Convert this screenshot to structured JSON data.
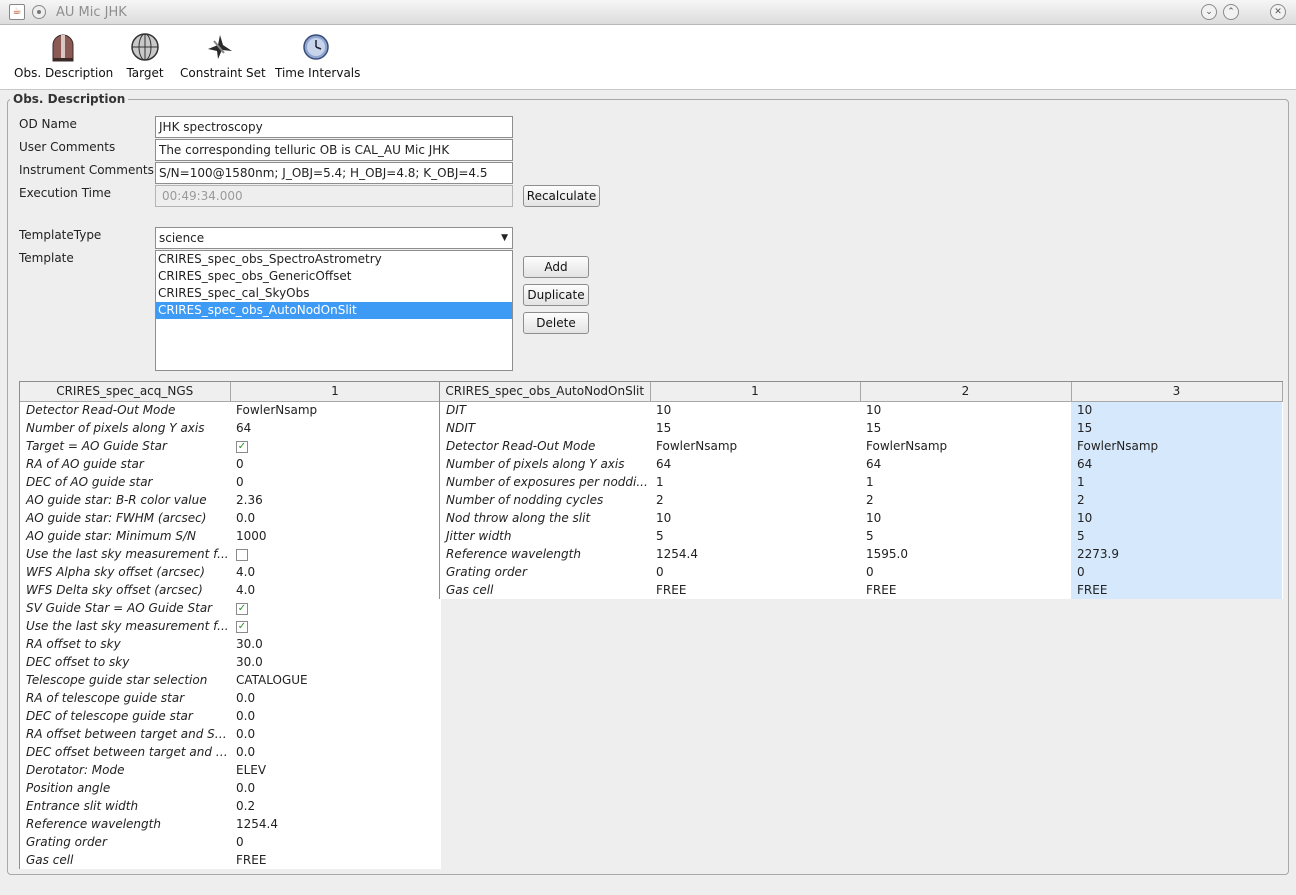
{
  "window": {
    "title": "AU Mic JHK"
  },
  "toolbar": {
    "items": [
      {
        "label": "Obs. Description",
        "icon": "telescope-dome-icon"
      },
      {
        "label": "Target",
        "icon": "globe-target-icon"
      },
      {
        "label": "Constraint Set",
        "icon": "constraint-set-icon"
      },
      {
        "label": "Time Intervals",
        "icon": "clock-icon"
      }
    ]
  },
  "obs_description": {
    "section_title": "Obs. Description",
    "od_name_label": "OD Name",
    "od_name_value": "JHK spectroscopy",
    "user_comments_label": "User Comments",
    "user_comments_value": "The corresponding telluric OB is CAL_AU Mic JHK",
    "instrument_comments_label": "Instrument Comments",
    "instrument_comments_value": "S/N=100@1580nm; J_OBJ=5.4; H_OBJ=4.8; K_OBJ=4.5",
    "execution_time_label": "Execution Time",
    "execution_time_value": "00:49:34.000",
    "recalculate_label": "Recalculate",
    "template_type_label": "TemplateType",
    "template_type_value": "science",
    "template_label": "Template",
    "templates": [
      "CRIRES_spec_obs_SpectroAstrometry",
      "CRIRES_spec_obs_GenericOffset",
      "CRIRES_spec_cal_SkyObs",
      "CRIRES_spec_obs_AutoNodOnSlit"
    ],
    "selected_template": "CRIRES_spec_obs_AutoNodOnSlit",
    "add_label": "Add",
    "duplicate_label": "Duplicate",
    "delete_label": "Delete"
  },
  "acq_table": {
    "headers": [
      "CRIRES_spec_acq_NGS",
      "1"
    ],
    "rows": [
      [
        "Detector Read-Out Mode",
        "FowlerNsamp"
      ],
      [
        "Number of pixels along Y axis",
        "64"
      ],
      [
        "Target = AO Guide Star",
        "checked"
      ],
      [
        "RA of AO guide star",
        "0"
      ],
      [
        "DEC of AO guide star",
        "0"
      ],
      [
        "AO guide star: B-R color value",
        "2.36"
      ],
      [
        "AO guide star: FWHM (arcsec)",
        "0.0"
      ],
      [
        "AO guide star: Minimum S/N",
        "1000"
      ],
      [
        "Use the last sky measurement f...",
        "unchecked"
      ],
      [
        "WFS Alpha sky offset (arcsec)",
        "4.0"
      ],
      [
        "WFS Delta sky offset (arcsec)",
        "4.0"
      ],
      [
        "SV Guide Star = AO Guide Star",
        "checked"
      ],
      [
        "Use the last sky measurement f...",
        "checked"
      ],
      [
        "RA offset to sky",
        "30.0"
      ],
      [
        "DEC offset to sky",
        "30.0"
      ],
      [
        "Telescope guide star selection",
        "CATALOGUE"
      ],
      [
        "RA of telescope guide star",
        "0.0"
      ],
      [
        "DEC of telescope guide star",
        "0.0"
      ],
      [
        "RA offset between target and SV...",
        "0.0"
      ],
      [
        "DEC offset between target and S...",
        "0.0"
      ],
      [
        "Derotator: Mode",
        "ELEV"
      ],
      [
        "Position angle",
        "0.0"
      ],
      [
        "Entrance slit width",
        "0.2"
      ],
      [
        "Reference wavelength",
        "1254.4"
      ],
      [
        "Grating order",
        "0"
      ],
      [
        "Gas cell",
        "FREE"
      ]
    ]
  },
  "obs_table": {
    "headers": [
      "CRIRES_spec_obs_AutoNodOnSlit",
      "1",
      "2",
      "3"
    ],
    "rows": [
      [
        "DIT",
        "10",
        "10",
        "10"
      ],
      [
        "NDIT",
        "15",
        "15",
        "15"
      ],
      [
        "Detector Read-Out Mode",
        "FowlerNsamp",
        "FowlerNsamp",
        "FowlerNsamp"
      ],
      [
        "Number of pixels along Y axis",
        "64",
        "64",
        "64"
      ],
      [
        "Number of exposures per noddi...",
        "1",
        "1",
        "1"
      ],
      [
        "Number of nodding cycles",
        "2",
        "2",
        "2"
      ],
      [
        "Nod throw along the slit",
        "10",
        "10",
        "10"
      ],
      [
        "Jitter width",
        "5",
        "5",
        "5"
      ],
      [
        "Reference wavelength",
        "1254.4",
        "1595.0",
        "2273.9"
      ],
      [
        "Grating order",
        "0",
        "0",
        "0"
      ],
      [
        "Gas cell",
        "FREE",
        "FREE",
        "FREE"
      ]
    ]
  },
  "colors": {
    "selection": "#3d9bf6",
    "column_highlight": "#d6e8fb"
  }
}
